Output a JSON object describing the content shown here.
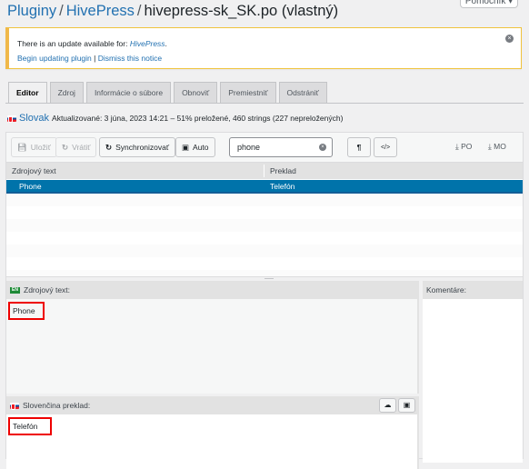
{
  "help_tab": {
    "label": "Pomocník ▾"
  },
  "breadcrumb": {
    "items": [
      "Pluginy",
      "HivePress"
    ],
    "current": "hivepress-sk_SK.po (vlastný)",
    "separator": "/"
  },
  "notice": {
    "text": "There is an update available for: ",
    "plugin_link": "HivePress",
    "text_end": ".",
    "begin_link": "Begin updating plugin",
    "separator": " | ",
    "dismiss_link": "Dismiss this notice",
    "dismiss_icon": "×"
  },
  "tabs": [
    {
      "label": "Editor",
      "active": true
    },
    {
      "label": "Zdroj",
      "active": false
    },
    {
      "label": "Informácie o súbore",
      "active": false
    },
    {
      "label": "Obnoviť",
      "active": false
    },
    {
      "label": "Premiestniť",
      "active": false
    },
    {
      "label": "Odstrániť",
      "active": false
    }
  ],
  "meta": {
    "language": "Slovak",
    "status": "Aktualizované: 3 júna, 2023 14:21 – 51% preložené, 460 strings (227 nepreložených)"
  },
  "toolbar": {
    "save_label": "Uložiť",
    "revert_label": "Vrátiť",
    "sync_label": "Synchronizovať",
    "auto_label": "Auto",
    "search_value": "phone",
    "pilcrow_label": "¶",
    "code_label": "</>",
    "download_po": "PO",
    "download_mo": "MO"
  },
  "grid": {
    "columns": [
      "Zdrojový text",
      "Preklad"
    ],
    "rows": [
      {
        "source": "Phone",
        "translation": "Telefón",
        "selected": true
      }
    ]
  },
  "source_pane": {
    "badge": "EN",
    "label": "Zdrojový text:",
    "value": "Phone"
  },
  "comments_pane": {
    "label": "Komentáre:"
  },
  "translation_pane": {
    "label": "Slovenčina preklad:",
    "value": "Telefón"
  },
  "colors": {
    "accent": "#2271b1",
    "selected_row": "#0073aa",
    "notice_border": "#f0b849",
    "highlight": "#ee0000"
  }
}
